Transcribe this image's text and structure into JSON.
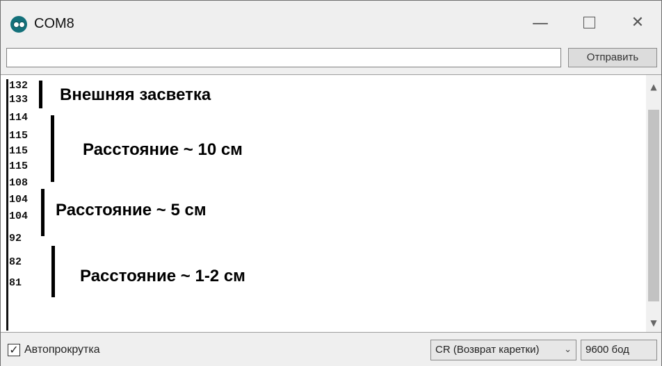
{
  "window": {
    "title": "COM8",
    "minimize_glyph": "—",
    "close_glyph": "✕"
  },
  "send_bar": {
    "input_value": "",
    "send_label": "Отправить"
  },
  "serial_output": {
    "lines": [
      "132",
      "133",
      "114",
      "115",
      "115",
      "115",
      "108",
      "104",
      "104",
      "92",
      "82",
      "81"
    ]
  },
  "annotations": [
    {
      "text": "Внешняя засветка"
    },
    {
      "text": "Расстояние ~ 10 см"
    },
    {
      "text": "Расстояние ~ 5 см"
    },
    {
      "text": "Расстояние ~ 1-2 см"
    }
  ],
  "status_bar": {
    "autoscroll_checked": true,
    "autoscroll_label": "Автопрокрутка",
    "line_ending": "CR (Возврат каретки)",
    "baud_rate": "9600 бод"
  },
  "icons": {
    "app": "arduino-logo-icon",
    "minimize": "minimize-icon",
    "maximize": "maximize-icon",
    "close": "close-icon",
    "scroll_up": "chevron-up-icon",
    "scroll_down": "chevron-down-icon",
    "dropdown": "chevron-down-icon",
    "check": "checkmark-icon"
  },
  "colors": {
    "accent": "#13707a"
  }
}
